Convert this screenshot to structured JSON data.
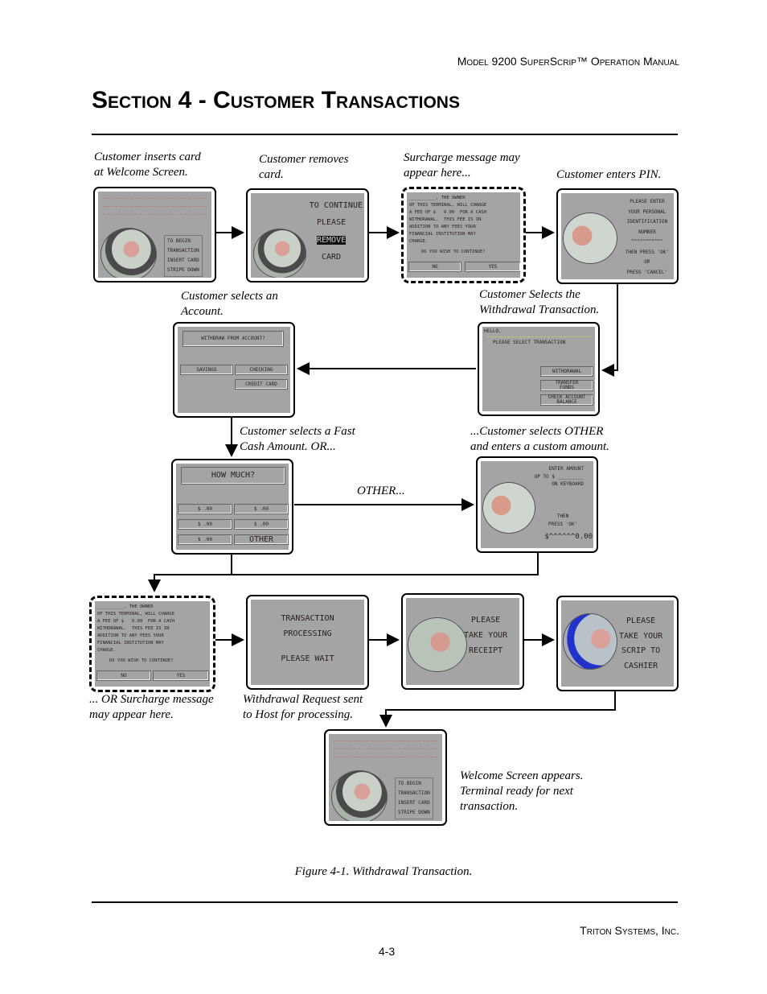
{
  "header": "Model 9200 SuperScrip™ Operation Manual",
  "title": "Section 4 - Customer Transactions",
  "captions": {
    "c1": "Customer inserts card\nat Welcome Screen.",
    "c2": "Customer removes\ncard.",
    "c3": "Surcharge message may\nappear here...",
    "c4": "Customer enters PIN.",
    "c5": "Customer selects an\nAccount.",
    "c6": "Customer Selects the\nWithdrawal Transaction.",
    "c7": "Customer selects a Fast\nCash Amount.  OR...",
    "c8": "...Customer selects OTHER\nand enters a custom amount.",
    "c9": "OTHER...",
    "c10": "... OR Surcharge message\nmay appear here.",
    "c11": "Withdrawal Request sent\nto Host for processing.",
    "c12": "Welcome Screen appears.\nTerminal ready for next\ntransaction."
  },
  "screens": {
    "welcome": {
      "lines": [
        "TO BEGIN",
        "TRANSACTION",
        "INSERT CARD",
        "STRIPE DOWN"
      ]
    },
    "remove": {
      "lines": [
        "TO CONTINUE",
        "PLEASE",
        "REMOVE",
        "CARD"
      ]
    },
    "surcharge": {
      "text": "__________, THE OWNER\nOF THIS TERMINAL, WILL CHARGE\nA FEE OF $   0.00  FOR A CASH\nWITHDRAWAL.  THIS FEE IS IN\nADDITION TO ANY FEES YOUR\nFINANCIAL INSTITUTION MAY\nCHARGE.",
      "question": "DO YOU WISH TO CONTINUE?",
      "no": "NO",
      "yes": "YES"
    },
    "pin": {
      "text": "PLEASE ENTER\nYOUR PERSONAL\nIDENTIFICATION\nNUMBER\n^^^^^^^^^^^\nTHEN PRESS 'OK'\nOR\nPRESS 'CANCEL'"
    },
    "account": {
      "title": "WITHDRAW FROM ACCOUNT?",
      "savings": "SAVINGS",
      "checking": "CHECKING",
      "credit": "CREDIT CARD"
    },
    "select": {
      "hello": "HELLO.",
      "prompt": "PLEASE SELECT TRANSACTION",
      "withdrawal": "WITHDRAWAL",
      "transfer": "TRANSFER\nFUNDS",
      "balance": "CHECK ACCOUNT\nBALANCE"
    },
    "howmuch": {
      "title": "HOW MUCH?",
      "amount": "$      .00",
      "other": "OTHER"
    },
    "enter": {
      "text": "ENTER AMOUNT\nUP TO $ _________\nON KEYBOARD",
      "then": "THEN\nPRESS 'OK'",
      "value": "$^^^^^^0.00"
    },
    "processing": {
      "l1": "TRANSACTION",
      "l2": "PROCESSING",
      "l3": "PLEASE WAIT"
    },
    "receipt": {
      "text": "PLEASE\nTAKE YOUR\nRECEIPT"
    },
    "scrip": {
      "text": "PLEASE\nTAKE YOUR\nSCRIP TO\nCASHIER"
    }
  },
  "figure_caption": "Figure 4-1. Withdrawal Transaction.",
  "footer": "Triton Systems, Inc.",
  "page_number": "4-3"
}
